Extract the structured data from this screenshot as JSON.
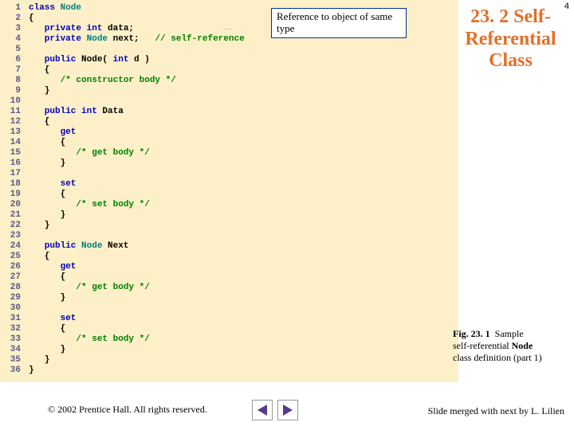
{
  "page_number": "4",
  "title_lines": [
    "23. 2  Self-",
    "Referential",
    "Class"
  ],
  "callout_text": "Reference to object of same type",
  "code_lines": [
    {
      "n": "1",
      "segs": [
        {
          "t": "class ",
          "c": "kw"
        },
        {
          "t": "Node",
          "c": "cls"
        }
      ]
    },
    {
      "n": "2",
      "segs": [
        {
          "t": "{",
          "c": ""
        }
      ]
    },
    {
      "n": "3",
      "segs": [
        {
          "t": "   private int ",
          "c": "kw"
        },
        {
          "t": "data;",
          "c": ""
        }
      ]
    },
    {
      "n": "4",
      "segs": [
        {
          "t": "   private ",
          "c": "kw"
        },
        {
          "t": "Node ",
          "c": "cls"
        },
        {
          "t": "next;   ",
          "c": ""
        },
        {
          "t": "// self-reference",
          "c": "cmt"
        }
      ]
    },
    {
      "n": "5",
      "segs": [
        {
          "t": "",
          "c": ""
        }
      ]
    },
    {
      "n": "6",
      "segs": [
        {
          "t": "   public ",
          "c": "kw"
        },
        {
          "t": "Node( ",
          "c": ""
        },
        {
          "t": "int ",
          "c": "kw"
        },
        {
          "t": "d )",
          "c": ""
        }
      ]
    },
    {
      "n": "7",
      "segs": [
        {
          "t": "   {",
          "c": ""
        }
      ]
    },
    {
      "n": "8",
      "segs": [
        {
          "t": "      /* constructor body */",
          "c": "cmt"
        }
      ]
    },
    {
      "n": "9",
      "segs": [
        {
          "t": "   }",
          "c": ""
        }
      ]
    },
    {
      "n": "10",
      "segs": [
        {
          "t": "",
          "c": ""
        }
      ]
    },
    {
      "n": "11",
      "segs": [
        {
          "t": "   public int ",
          "c": "kw"
        },
        {
          "t": "Data",
          "c": ""
        }
      ]
    },
    {
      "n": "12",
      "segs": [
        {
          "t": "   {",
          "c": ""
        }
      ]
    },
    {
      "n": "13",
      "segs": [
        {
          "t": "      get",
          "c": "kw"
        }
      ]
    },
    {
      "n": "14",
      "segs": [
        {
          "t": "      {",
          "c": ""
        }
      ]
    },
    {
      "n": "15",
      "segs": [
        {
          "t": "         /* get body */",
          "c": "cmt"
        }
      ]
    },
    {
      "n": "16",
      "segs": [
        {
          "t": "      }",
          "c": ""
        }
      ]
    },
    {
      "n": "17",
      "segs": [
        {
          "t": "",
          "c": ""
        }
      ]
    },
    {
      "n": "18",
      "segs": [
        {
          "t": "      set",
          "c": "kw"
        }
      ]
    },
    {
      "n": "19",
      "segs": [
        {
          "t": "      {",
          "c": ""
        }
      ]
    },
    {
      "n": "20",
      "segs": [
        {
          "t": "         /* set body */",
          "c": "cmt"
        }
      ]
    },
    {
      "n": "21",
      "segs": [
        {
          "t": "      }",
          "c": ""
        }
      ]
    },
    {
      "n": "22",
      "segs": [
        {
          "t": "   }",
          "c": ""
        }
      ]
    },
    {
      "n": "23",
      "segs": [
        {
          "t": "",
          "c": ""
        }
      ]
    },
    {
      "n": "24",
      "segs": [
        {
          "t": "   public ",
          "c": "kw"
        },
        {
          "t": "Node ",
          "c": "cls"
        },
        {
          "t": "Next",
          "c": ""
        }
      ]
    },
    {
      "n": "25",
      "segs": [
        {
          "t": "   {",
          "c": ""
        }
      ]
    },
    {
      "n": "26",
      "segs": [
        {
          "t": "      get",
          "c": "kw"
        }
      ]
    },
    {
      "n": "27",
      "segs": [
        {
          "t": "      {",
          "c": ""
        }
      ]
    },
    {
      "n": "28",
      "segs": [
        {
          "t": "         /* get body */",
          "c": "cmt"
        }
      ]
    },
    {
      "n": "29",
      "segs": [
        {
          "t": "      }",
          "c": ""
        }
      ]
    },
    {
      "n": "30",
      "segs": [
        {
          "t": "",
          "c": ""
        }
      ]
    },
    {
      "n": "31",
      "segs": [
        {
          "t": "      set",
          "c": "kw"
        }
      ]
    },
    {
      "n": "32",
      "segs": [
        {
          "t": "      {",
          "c": ""
        }
      ]
    },
    {
      "n": "33",
      "segs": [
        {
          "t": "         /* set body */",
          "c": "cmt"
        }
      ]
    },
    {
      "n": "34",
      "segs": [
        {
          "t": "      }",
          "c": ""
        }
      ]
    },
    {
      "n": "35",
      "segs": [
        {
          "t": "   }",
          "c": ""
        }
      ]
    },
    {
      "n": "36",
      "segs": [
        {
          "t": "}",
          "c": ""
        }
      ]
    }
  ],
  "fig_label": "Fig. 23. 1",
  "fig_rest_1": "Sample",
  "fig_rest_2": "self-referential",
  "fig_bold": "Node",
  "fig_rest_3": "class definition (part 1)",
  "copyright": "© 2002 Prentice Hall.  All rights reserved.",
  "merged_note": "Slide merged with next  by L. Lilien"
}
